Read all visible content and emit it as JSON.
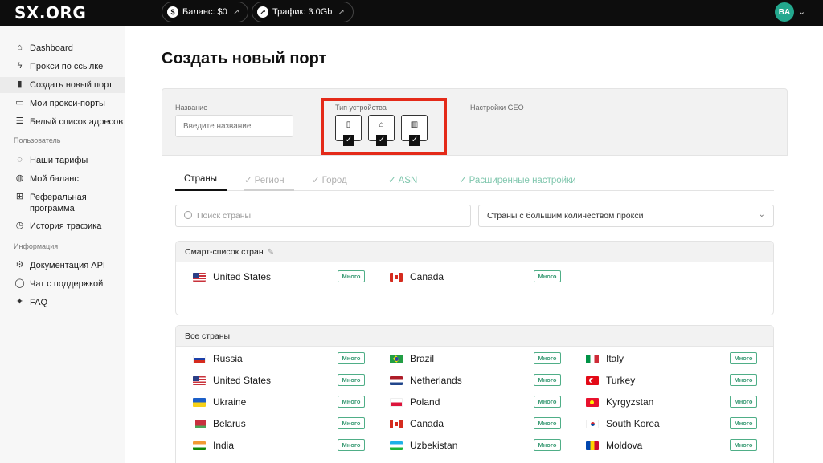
{
  "brand": {
    "logo": "SX.ORG"
  },
  "topbar": {
    "balance": "Баланс: $0",
    "traffic": "Трафик: 3.0Gb",
    "avatar": "BA"
  },
  "sidebar": {
    "items": [
      {
        "label": "Dashboard",
        "icon": "home-icon"
      },
      {
        "label": "Прокси по ссылке",
        "icon": "bolt-icon"
      },
      {
        "label": "Создать новый порт",
        "icon": "add-file-icon",
        "active": true
      },
      {
        "label": "Мои прокси-порты",
        "icon": "ports-icon"
      },
      {
        "label": "Белый список адресов",
        "icon": "list-icon"
      }
    ],
    "section_user": "Пользователь",
    "user_items": [
      {
        "label": "Наши тарифы",
        "icon": "tariff-icon"
      },
      {
        "label": "Мой баланс",
        "icon": "wallet-icon"
      },
      {
        "label": "Реферальная программа",
        "icon": "gift-icon"
      },
      {
        "label": "История трафика",
        "icon": "clock-icon"
      }
    ],
    "section_info": "Информация",
    "info_items": [
      {
        "label": "Документация API",
        "icon": "gear-icon"
      },
      {
        "label": "Чат с поддержкой",
        "icon": "chat-icon"
      },
      {
        "label": "FAQ",
        "icon": "sparkle-icon"
      }
    ]
  },
  "main": {
    "title": "Создать новый порт",
    "form": {
      "name_label": "Название",
      "name_placeholder": "Введите название",
      "device_label": "Тип устройства",
      "geo_label": "Настройки GEO",
      "devices": [
        {
          "icon": "mobile-icon",
          "checked": true
        },
        {
          "icon": "home-icon",
          "checked": true
        },
        {
          "icon": "building-icon",
          "checked": true
        }
      ]
    },
    "tabs": [
      {
        "label": "Страны",
        "state": "active"
      },
      {
        "label": "Регион",
        "state": "dim"
      },
      {
        "label": "Город",
        "state": "dim"
      },
      {
        "label": "ASN",
        "state": "ok"
      },
      {
        "label": "Расширенные настройки",
        "state": "ok"
      }
    ],
    "search_placeholder": "Поиск страны",
    "sort_select": "Страны с большим количеством прокси",
    "smart_list": {
      "title": "Смарт-список стран",
      "countries": [
        {
          "name": "United States",
          "badge": "Много"
        },
        {
          "name": "Canada",
          "badge": "Много"
        }
      ]
    },
    "all_countries": {
      "title": "Все страны",
      "countries": [
        {
          "name": "Russia",
          "badge": "Много"
        },
        {
          "name": "Brazil",
          "badge": "Много"
        },
        {
          "name": "Italy",
          "badge": "Много"
        },
        {
          "name": "United States",
          "badge": "Много"
        },
        {
          "name": "Netherlands",
          "badge": "Много"
        },
        {
          "name": "Turkey",
          "badge": "Много"
        },
        {
          "name": "Ukraine",
          "badge": "Много"
        },
        {
          "name": "Poland",
          "badge": "Много"
        },
        {
          "name": "Kyrgyzstan",
          "badge": "Много"
        },
        {
          "name": "Belarus",
          "badge": "Много"
        },
        {
          "name": "Canada",
          "badge": "Много"
        },
        {
          "name": "South Korea",
          "badge": "Много"
        },
        {
          "name": "India",
          "badge": "Много"
        },
        {
          "name": "Uzbekistan",
          "badge": "Много"
        },
        {
          "name": "Moldova",
          "badge": "Много"
        }
      ]
    }
  },
  "colors": {
    "accent_green": "#3b9b75",
    "highlight_red": "#e42a19",
    "topbar_bg": "#0d0d0d",
    "avatar_bg": "#23a88e"
  }
}
